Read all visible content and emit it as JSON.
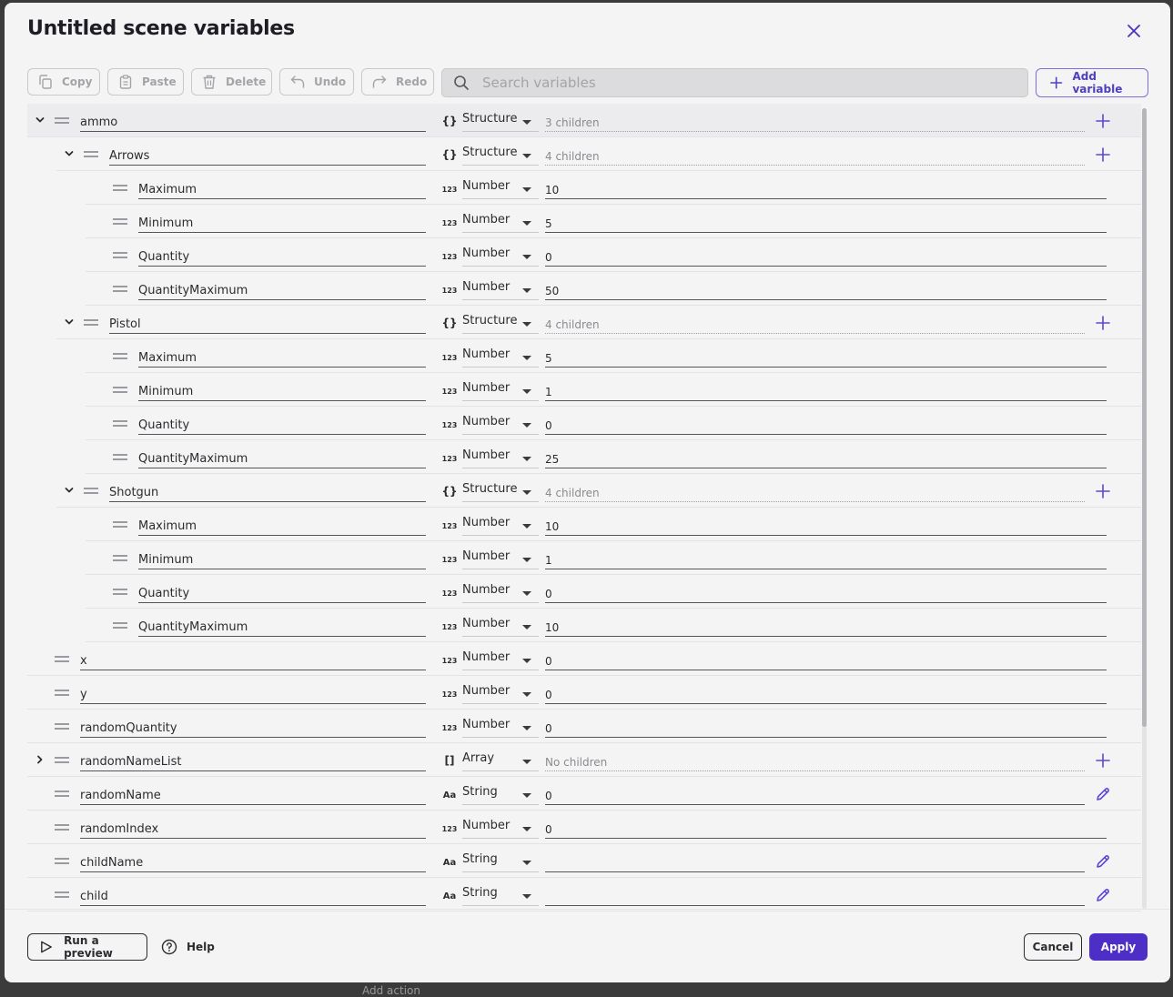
{
  "dialog": {
    "title": "Untitled scene variables"
  },
  "toolbar": {
    "copy_label": "Copy",
    "paste_label": "Paste",
    "delete_label": "Delete",
    "undo_label": "Undo",
    "redo_label": "Redo",
    "search_placeholder": "Search variables",
    "add_variable_label": "Add variable"
  },
  "colors": {
    "accent": "#4d2fc8",
    "accent_light": "#7d6ee0",
    "background": "#f4f4f4"
  },
  "variables": [
    {
      "depth": 0,
      "chevron": "expanded",
      "name": "ammo",
      "type_icon": "{}",
      "type": "Structure",
      "value": "3 children",
      "dim": true,
      "action": "add"
    },
    {
      "depth": 1,
      "chevron": "expanded",
      "name": "Arrows",
      "type_icon": "{}",
      "type": "Structure",
      "value": "4 children",
      "dim": true,
      "action": "add"
    },
    {
      "depth": 2,
      "chevron": "",
      "name": "Maximum",
      "type_icon": "123",
      "type": "Number",
      "value": "10",
      "dim": false,
      "action": ""
    },
    {
      "depth": 2,
      "chevron": "",
      "name": "Minimum",
      "type_icon": "123",
      "type": "Number",
      "value": "5",
      "dim": false,
      "action": ""
    },
    {
      "depth": 2,
      "chevron": "",
      "name": "Quantity",
      "type_icon": "123",
      "type": "Number",
      "value": "0",
      "dim": false,
      "action": ""
    },
    {
      "depth": 2,
      "chevron": "",
      "name": "QuantityMaximum",
      "type_icon": "123",
      "type": "Number",
      "value": "50",
      "dim": false,
      "action": ""
    },
    {
      "depth": 1,
      "chevron": "expanded",
      "name": "Pistol",
      "type_icon": "{}",
      "type": "Structure",
      "value": "4 children",
      "dim": true,
      "action": "add"
    },
    {
      "depth": 2,
      "chevron": "",
      "name": "Maximum",
      "type_icon": "123",
      "type": "Number",
      "value": "5",
      "dim": false,
      "action": ""
    },
    {
      "depth": 2,
      "chevron": "",
      "name": "Minimum",
      "type_icon": "123",
      "type": "Number",
      "value": "1",
      "dim": false,
      "action": ""
    },
    {
      "depth": 2,
      "chevron": "",
      "name": "Quantity",
      "type_icon": "123",
      "type": "Number",
      "value": "0",
      "dim": false,
      "action": ""
    },
    {
      "depth": 2,
      "chevron": "",
      "name": "QuantityMaximum",
      "type_icon": "123",
      "type": "Number",
      "value": "25",
      "dim": false,
      "action": ""
    },
    {
      "depth": 1,
      "chevron": "expanded",
      "name": "Shotgun",
      "type_icon": "{}",
      "type": "Structure",
      "value": "4 children",
      "dim": true,
      "action": "add"
    },
    {
      "depth": 2,
      "chevron": "",
      "name": "Maximum",
      "type_icon": "123",
      "type": "Number",
      "value": "10",
      "dim": false,
      "action": ""
    },
    {
      "depth": 2,
      "chevron": "",
      "name": "Minimum",
      "type_icon": "123",
      "type": "Number",
      "value": "1",
      "dim": false,
      "action": ""
    },
    {
      "depth": 2,
      "chevron": "",
      "name": "Quantity",
      "type_icon": "123",
      "type": "Number",
      "value": "0",
      "dim": false,
      "action": ""
    },
    {
      "depth": 2,
      "chevron": "",
      "name": "QuantityMaximum",
      "type_icon": "123",
      "type": "Number",
      "value": "10",
      "dim": false,
      "action": ""
    },
    {
      "depth": 0,
      "chevron": "",
      "name": "x",
      "type_icon": "123",
      "type": "Number",
      "value": "0",
      "dim": false,
      "action": ""
    },
    {
      "depth": 0,
      "chevron": "",
      "name": "y",
      "type_icon": "123",
      "type": "Number",
      "value": "0",
      "dim": false,
      "action": ""
    },
    {
      "depth": 0,
      "chevron": "",
      "name": "randomQuantity",
      "type_icon": "123",
      "type": "Number",
      "value": "0",
      "dim": false,
      "action": ""
    },
    {
      "depth": 0,
      "chevron": "collapsed",
      "name": "randomNameList",
      "type_icon": "[]",
      "type": "Array",
      "value": "No children",
      "dim": true,
      "action": "add"
    },
    {
      "depth": 0,
      "chevron": "",
      "name": "randomName",
      "type_icon": "Aa",
      "type": "String",
      "value": "0",
      "dim": false,
      "action": "edit"
    },
    {
      "depth": 0,
      "chevron": "",
      "name": "randomIndex",
      "type_icon": "123",
      "type": "Number",
      "value": "0",
      "dim": false,
      "action": ""
    },
    {
      "depth": 0,
      "chevron": "",
      "name": "childName",
      "type_icon": "Aa",
      "type": "String",
      "value": "",
      "dim": false,
      "action": "edit"
    },
    {
      "depth": 0,
      "chevron": "",
      "name": "child",
      "type_icon": "Aa",
      "type": "String",
      "value": "",
      "dim": false,
      "action": "edit"
    }
  ],
  "footer": {
    "run_preview_label": "Run a preview",
    "help_label": "Help",
    "cancel_label": "Cancel",
    "apply_label": "Apply"
  },
  "background": {
    "behind_text": "Add action"
  }
}
